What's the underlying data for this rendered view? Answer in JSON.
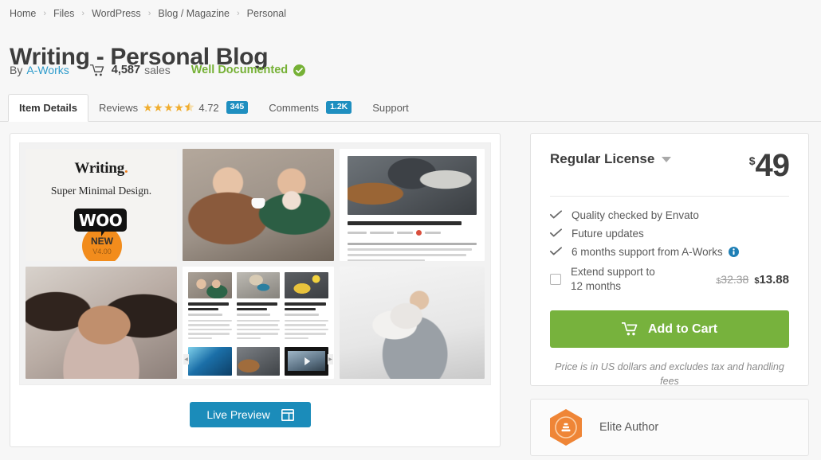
{
  "breadcrumb": {
    "separator": "›",
    "items": [
      {
        "label": "Home"
      },
      {
        "label": "Files"
      },
      {
        "label": "WordPress"
      },
      {
        "label": "Blog / Magazine"
      },
      {
        "label": "Personal"
      }
    ]
  },
  "header": {
    "title": "Writing - Personal Blog",
    "by_label": "By",
    "author": "A-Works",
    "sales_count": "4,587",
    "sales_word": "sales",
    "badge_label": "Well Documented",
    "cart_icon": "cart-icon",
    "check_icon": "check-circle-icon"
  },
  "tabs": [
    {
      "label": "Item Details",
      "active": true
    },
    {
      "label": "Reviews",
      "rating": "4.72",
      "stars": 4.5,
      "badge": "345",
      "active": false
    },
    {
      "label": "Comments",
      "badge": "1.2K",
      "active": false
    },
    {
      "label": "Support",
      "active": false
    }
  ],
  "preview": {
    "brand_word": "Writing",
    "brand_dot": ".",
    "brand_sub": "Super Minimal Design.",
    "woo_logo": "WOO",
    "woo_new": "NEW",
    "woo_version": "V4.00",
    "tiles": [
      {
        "name": "brand-tile"
      },
      {
        "name": "cafe-couple-photo"
      },
      {
        "name": "article-mockup"
      },
      {
        "name": "woman-portrait-photo"
      },
      {
        "name": "blog-grid-mockup"
      },
      {
        "name": "father-child-photo"
      }
    ],
    "live_preview_label": "Live Preview",
    "live_preview_icon": "layout-icon"
  },
  "sidebar": {
    "license_name": "Regular License",
    "license_caret_icon": "chevron-down-icon",
    "currency": "$",
    "price": "49",
    "features": [
      {
        "label": "Quality checked by Envato",
        "icon": "check-icon",
        "info": false
      },
      {
        "label": "Future updates",
        "icon": "check-icon",
        "info": false
      },
      {
        "label": "6 months support from A-Works",
        "icon": "check-icon",
        "info": true,
        "info_icon": "info-icon"
      }
    ],
    "extend": {
      "checkbox_icon": "checkbox-unchecked",
      "label": "Extend support to 12 months",
      "old_currency": "$",
      "old_price": "32.38",
      "new_currency": "$",
      "new_price": "13.88",
      "checked": false
    },
    "cart_button_label": "Add to Cart",
    "cart_button_icon": "cart-icon",
    "fineprint": "Price is in US dollars and excludes tax and handling fees",
    "elite": {
      "label": "Elite Author",
      "icon": "elite-author-hexagon-icon"
    }
  },
  "colors": {
    "accent_blue": "#1b8cba",
    "badge_blue": "#1f8fc0",
    "cart_green": "#77b23d",
    "doc_green": "#76b136",
    "star_orange": "#f0ad2e",
    "elite_orange": "#f08326",
    "link_blue": "#2f9ccc"
  }
}
